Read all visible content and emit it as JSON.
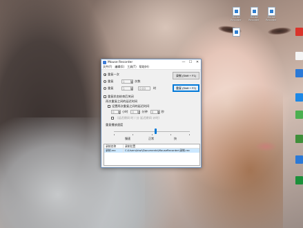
{
  "desktop": {
    "icons": [
      {
        "label": "Mouse Recorder"
      },
      {
        "label": "Mouse Recorder"
      },
      {
        "label": "Mouse Recorder"
      }
    ]
  },
  "window": {
    "title": "Mouse Recorder",
    "controls": {
      "minimize": "—",
      "maximize": "☐",
      "close": "✕"
    },
    "menu": [
      "文件(F)",
      "编辑(E)",
      "工具(T)",
      "帮助(H)"
    ],
    "repeat": {
      "once_label": "重复一次",
      "times_label": "重复",
      "times_value": "1",
      "times_unit": "次数",
      "until_label": "重复",
      "until_value": "1",
      "until_time": "0:00",
      "until_unit": "时"
    },
    "options": {
      "check1": "重复状态结束后关闭",
      "group_title": "再次重复之间的延迟时间",
      "check2": "设置两次重复之间的延迟时间",
      "hours_value": "0",
      "hours_unit": "小时",
      "minutes_value": "0",
      "minutes_unit": "分钟",
      "seconds_value": "0",
      "seconds_unit": "秒",
      "note": "（延迟期间 时 / 分 延迟期间 计时）"
    },
    "buttons": {
      "record": "录制 (Shift + F1)",
      "replay": "重复 (Shift + F2)"
    },
    "speed": {
      "title": "重复播放速度",
      "slow": "慢速",
      "normal": "正常",
      "fast": "快",
      "level": 0.55
    },
    "list": {
      "columns": [
        "录制名称",
        "录制位置"
      ],
      "rows": [
        {
          "name": "录制.rec",
          "path": "C:\\Users\\kiwi\\Documents\\MouseRecorder\\录制.rec"
        }
      ]
    }
  },
  "colors": {
    "accent": "#0078d7",
    "selection": "#cce8ff"
  }
}
